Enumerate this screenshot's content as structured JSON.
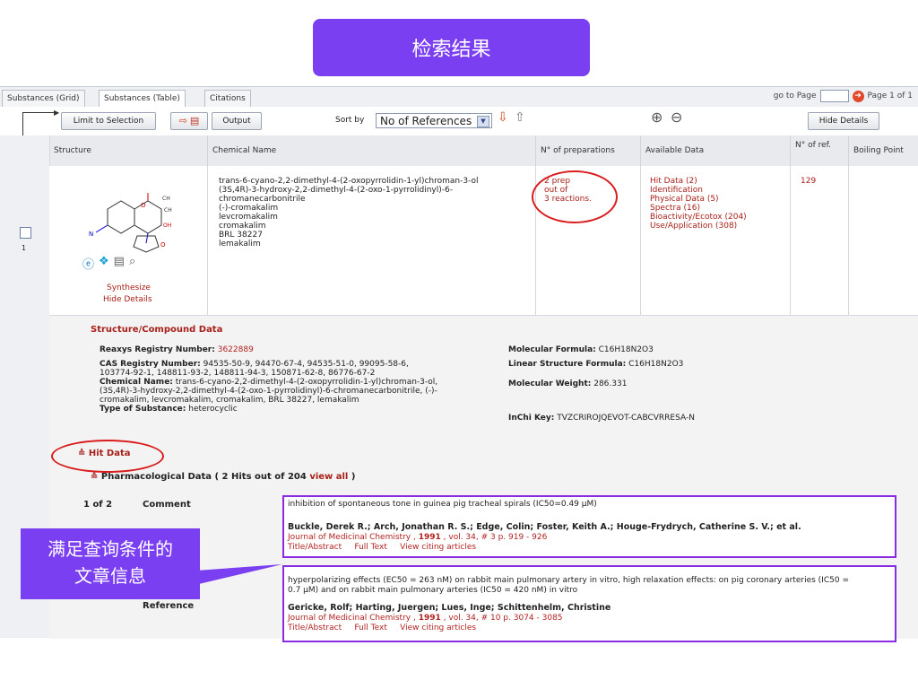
{
  "title": "检索结果",
  "tabs": [
    "Substances (Grid)",
    "Substances (Table)",
    "Citations"
  ],
  "goto": {
    "label": "go to Page",
    "page_info": "Page 1 of 1"
  },
  "toolbar": {
    "limit": "Limit to Selection",
    "output": "Output",
    "sort_by": "Sort by",
    "sort_value": "No of References",
    "hide_details": "Hide Details"
  },
  "columns": [
    "Structure",
    "Chemical Name",
    "N° of preparations",
    "Available Data",
    "N° of ref.",
    "Boiling Point"
  ],
  "row": {
    "index": "1",
    "names": [
      "trans-6-cyano-2,2-dimethyl-4-(2-oxopyrrolidin-1-yl)chroman-3-ol",
      "(3S,4R)-3-hydroxy-2,2-dimethyl-4-(2-oxo-1-pyrrolidinyl)-6-",
      "chromanecarbonitrile",
      "(-)-cromakalim",
      "levcromakalim",
      "cromakalim",
      "BRL 38227",
      "lemakalim"
    ],
    "preps": [
      "2 prep",
      "out of",
      "3 reactions."
    ],
    "available": [
      "Hit Data (2)",
      "Identification",
      "Physical Data (5)",
      "Spectra (16)",
      "Bioactivity/Ecotox (204)",
      "Use/Application (308)"
    ],
    "refs": "129",
    "synthesize": "Synthesize",
    "hide": "Hide Details"
  },
  "details": {
    "section": "Structure/Compound Data",
    "reaxys_label": "Reaxys Registry Number:",
    "reaxys_value": "3622889",
    "cas_label": "CAS Registry Number:",
    "cas_value": "94535-50-9, 94470-67-4, 94535-51-0, 99095-58-6,",
    "cas_value2": "103774-92-1, 148811-93-2, 148811-94-3, 150871-62-8, 86776-67-2",
    "chem_label": "Chemical Name:",
    "chem_value": "trans-6-cyano-2,2-dimethyl-4-(2-oxopyrrolidin-1-yl)chroman-3-ol,",
    "chem_value2": "(3S,4R)-3-hydroxy-2,2-dimethyl-4-(2-oxo-1-pyrrolidinyl)-6-chromanecarbonitrile, (-)-",
    "chem_value3": "cromakalim, levcromakalim, cromakalim, BRL 38227, lemakalim",
    "type_label": "Type of Substance:",
    "type_value": "heterocyclic",
    "mf_label": "Molecular Formula:",
    "mf_value": "C16H18N2O3",
    "lsf_label": "Linear Structure Formula:",
    "lsf_value": "C16H18N2O3",
    "mw_label": "Molecular Weight:",
    "mw_value": "286.331",
    "inchi_label": "InChi Key:",
    "inchi_value": "TVZCRIROJQEVOT-CABCVRRESA-N",
    "hit_data": "Hit Data",
    "pharma": "Pharmacological Data ( 2 Hits out of 204",
    "view_all": "view all",
    "pharma_end": ")",
    "count": "1 of 2",
    "comment_label": "Comment",
    "reference_label": "Reference",
    "comment1": "inhibition of spontaneous tone in guinea pig tracheal spirals (IC50=0.49 µM)",
    "authors1": "Buckle, Derek R.; Arch, Jonathan R. S.; Edge, Colin; Foster, Keith A.; Houge-Frydrych, Catherine S. V.; et al.",
    "journal1": "Journal of Medicinal Chemistry ,",
    "year1": "1991",
    "vol1": ", vol. 34, # 3 p. 919 - 926",
    "links": "Title/Abstract     Full Text     View citing articles",
    "comment2a": "hyperpolarizing effects (EC50 = 263 nM) on rabbit main pulmonary artery in vitro, high relaxation effects: on pig coronary arteries (IC50 =",
    "comment2b": "0.7 µM) and on rabbit main pulmonary arteries (IC50 = 420 nM) in vitro",
    "authors2": "Gericke, Rolf; Harting, Juergen; Lues, Inge; Schittenhelm, Christine",
    "journal2": "Journal of Medicinal Chemistry ,",
    "year2": "1991",
    "vol2": ", vol. 34, # 10 p. 3074 - 3085"
  },
  "callout": [
    "满足查询条件的",
    "文章信息"
  ]
}
